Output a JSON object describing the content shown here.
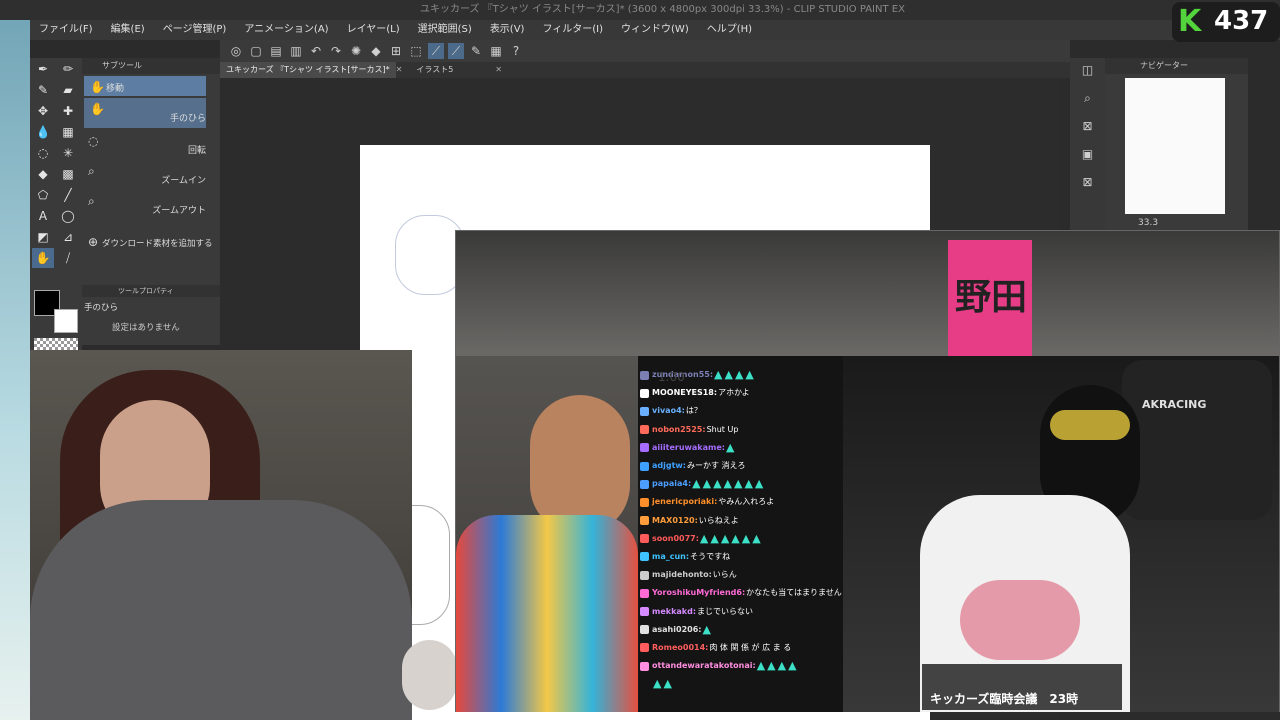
{
  "window": {
    "title": "ユキッカーズ 『Tシャツ イラスト[サーカス]* (3600 x 4800px 300dpi 33.3%) - CLIP STUDIO PAINT EX"
  },
  "menu": [
    "ファイル(F)",
    "編集(E)",
    "ページ管理(P)",
    "アニメーション(A)",
    "レイヤー(L)",
    "選択範囲(S)",
    "表示(V)",
    "フィルター(I)",
    "ウィンドウ(W)",
    "ヘルプ(H)"
  ],
  "tabs": [
    {
      "label": "ユキッカーズ 『Tシャツ イラスト[サーカス]*"
    },
    {
      "label": "イラスト5"
    }
  ],
  "subtool": {
    "header": "サブツール",
    "items": [
      {
        "label": "移動",
        "icon": "hand-icon"
      },
      {
        "label": "手のひら",
        "icon": "hand-icon"
      },
      {
        "label": "回転",
        "icon": "rotate-icon"
      },
      {
        "label": "ズームイン",
        "icon": "zoom-in-icon"
      },
      {
        "label": "ズームアウト",
        "icon": "zoom-out-icon"
      },
      {
        "label": "ダウンロード素材を追加する",
        "icon": "plus-circle-icon"
      }
    ]
  },
  "toolprop": {
    "header": "ツールプロパティ",
    "tool": "手のひら",
    "empty": "設定はありません"
  },
  "navigator": {
    "header": "ナビゲーター",
    "zoom": "33.3"
  },
  "badge": {
    "logo": "K",
    "count": "437"
  },
  "stream": {
    "caption": "キッカーズ臨時会議　23時",
    "banner": "野田",
    "chair": "AKRACING",
    "ghost": "1.00"
  },
  "chat": [
    {
      "user": "zundamon55:",
      "msg": "",
      "emo": "▲▲▲▲",
      "color": "#7b7fb3"
    },
    {
      "user": "MOONEYES18:",
      "msg": " アホかよ",
      "emo": "",
      "color": "#ffffff"
    },
    {
      "user": "vivao4:",
      "msg": " は？",
      "emo": "",
      "color": "#6ab0ff"
    },
    {
      "user": "nobon2525:",
      "msg": " Shut Up",
      "emo": "",
      "color": "#ff6a5a"
    },
    {
      "user": "aiiiteruwakame:",
      "msg": "",
      "emo": "▲",
      "color": "#a56cff"
    },
    {
      "user": "adjgtw:",
      "msg": " みーかす 消えろ",
      "emo": "",
      "color": "#3fa1ff"
    },
    {
      "user": "papaia4:",
      "msg": "",
      "emo": "▲▲▲▲▲▲▲",
      "color": "#4d9fff"
    },
    {
      "user": "jenericporiaki:",
      "msg": " やみん入れろよ",
      "emo": "",
      "color": "#ff8f2a"
    },
    {
      "user": "MAX0120:",
      "msg": " いらねえよ",
      "emo": "",
      "color": "#ff9c3b"
    },
    {
      "user": "soon0077:",
      "msg": "",
      "emo": "▲▲▲▲▲▲",
      "color": "#ff5a5a"
    },
    {
      "user": "ma_cun:",
      "msg": " そうですね",
      "emo": "",
      "color": "#3ec3ff"
    },
    {
      "user": "majidehonto:",
      "msg": " いらん",
      "emo": "",
      "color": "#cccccc"
    },
    {
      "user": "YoroshikuMyfriend6:",
      "msg": " かなたも当てはまりません",
      "emo": "",
      "color": "#ff6bd6"
    },
    {
      "user": "mekkakd:",
      "msg": " まじでいらない",
      "emo": "",
      "color": "#d58bff"
    },
    {
      "user": "asahi0206:",
      "msg": "",
      "emo": "▲",
      "color": "#e0e0e0"
    },
    {
      "user": "Romeo0014:",
      "msg": " 肉 体 関 係 が 広 ま る",
      "emo": "",
      "color": "#ff5d5d"
    },
    {
      "user": "ottandewaratakotonai:",
      "msg": "",
      "emo": "▲▲▲▲",
      "color": "#ff8ee0"
    },
    {
      "user": "",
      "msg": "",
      "emo": "▲▲",
      "color": "#ffffff"
    }
  ],
  "colors": {
    "accent": "#4a6b8e",
    "brand": "#53d43c",
    "banner": "#e63d86",
    "emote": "#3be0c7"
  }
}
